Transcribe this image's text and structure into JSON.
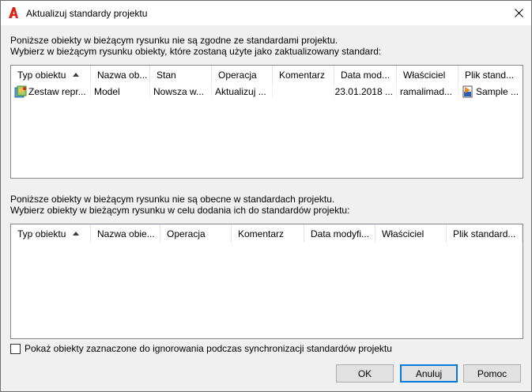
{
  "window": {
    "title": "Aktualizuj standardy projektu",
    "app_icon": "autocad-icon",
    "close_icon": "close-icon"
  },
  "section1": {
    "line1": "Poniższe obiekty w bieżącym rysunku nie są zgodne ze standardami projektu.",
    "line2": "Wybierz w bieżącym rysunku obiekty, które zostaną użyte jako zaktualizowany standard:",
    "columns": [
      "Typ obiektu",
      "Nazwa ob...",
      "Stan",
      "Operacja",
      "Komentarz",
      "Data mod...",
      "Właściciel",
      "Plik stand..."
    ],
    "sorted_column": "Typ obiektu",
    "rows": [
      {
        "cells": [
          "Zestaw repr...",
          "Model",
          "Nowsza w...",
          "Aktualizuj ...",
          "",
          "23.01.2018 ...",
          "ramalimad...",
          "Sample ..."
        ],
        "type_icon": "sheet-set-icon",
        "file_icon": "standards-file-icon"
      }
    ]
  },
  "section2": {
    "line1": "Poniższe obiekty w bieżącym rysunku nie są obecne w standardach projektu.",
    "line2": "Wybierz obiekty w bieżącym rysunku w celu dodania ich do standardów projektu:",
    "columns": [
      "Typ obiektu",
      "Nazwa obie...",
      "Operacja",
      "Komentarz",
      "Data modyfi...",
      "Właściciel",
      "Plik standard..."
    ],
    "sorted_column": "Typ obiektu",
    "rows": []
  },
  "options": {
    "show_ignored_label": "Pokaż obiekty zaznaczone do ignorowania podczas synchronizacji standardów projektu",
    "show_ignored_checked": false
  },
  "buttons": {
    "ok": "OK",
    "cancel": "Anuluj",
    "help": "Pomoc"
  }
}
